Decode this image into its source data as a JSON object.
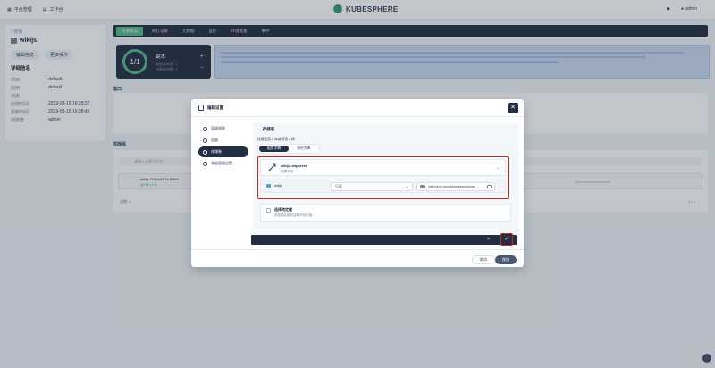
{
  "header": {
    "platform": "平台管理",
    "workbench": "工作台",
    "brand": "KUBESPHERE",
    "user": "admin"
  },
  "left_panel": {
    "back": "存储",
    "app_name": "wikijs",
    "btn_edit": "编辑信息",
    "btn_more": "更多操作",
    "attr_title": "详细信息",
    "attrs": [
      {
        "k": "项目",
        "v": "default"
      },
      {
        "k": "应用",
        "v": "default"
      },
      {
        "k": "状态",
        "v": ""
      },
      {
        "k": "创建时间",
        "v": "2019-08-15 16:28:37"
      },
      {
        "k": "更新时间",
        "v": "2019-08-15 16:28:40"
      },
      {
        "k": "创建者",
        "v": "admin"
      }
    ]
  },
  "tabs": [
    "资源状态",
    "修订记录",
    "元数据",
    "监控",
    "环境变量",
    "事件"
  ],
  "replica": {
    "count": "1/1",
    "label": "副本",
    "desired": "期望副本数: 1",
    "current": "当前副本数: 1"
  },
  "sections": {
    "ports": "端口",
    "pods": "容器组"
  },
  "pods": {
    "filter_placeholder": "请输入关键字过滤",
    "pod_name": "wikijs-7f3cbc8474-8l9b9",
    "pod_status": "运行中 (1/1)",
    "total": "总数: 1",
    "pager": "1 / 1"
  },
  "modal": {
    "title": "编辑设置",
    "close_icon": "close-icon",
    "steps": [
      "容器镜像",
      "容器",
      "存储卷",
      "高级容器设置"
    ],
    "active_step_index": 2,
    "back_title": "存储卷",
    "hint": "挂载配置字典或保密字典",
    "subtabs": [
      "配置字典",
      "保密字典"
    ],
    "volume": {
      "name": "wikijs-dnparser",
      "type": "配置字典"
    },
    "mount": {
      "container": "wikijs",
      "mode": "只读",
      "path": "/wiki/server/modules/search/post"
    },
    "secret": {
      "title": "选择特定键",
      "desc": "选择要挂载到容器的特定键。"
    },
    "cancel_icon": "×",
    "confirm_icon": "✓",
    "cancel_button": "取消",
    "next_button": "保存"
  },
  "colors": {
    "accent": "#55bc8a",
    "dark": "#242e42",
    "highlight": "#ca2621"
  }
}
